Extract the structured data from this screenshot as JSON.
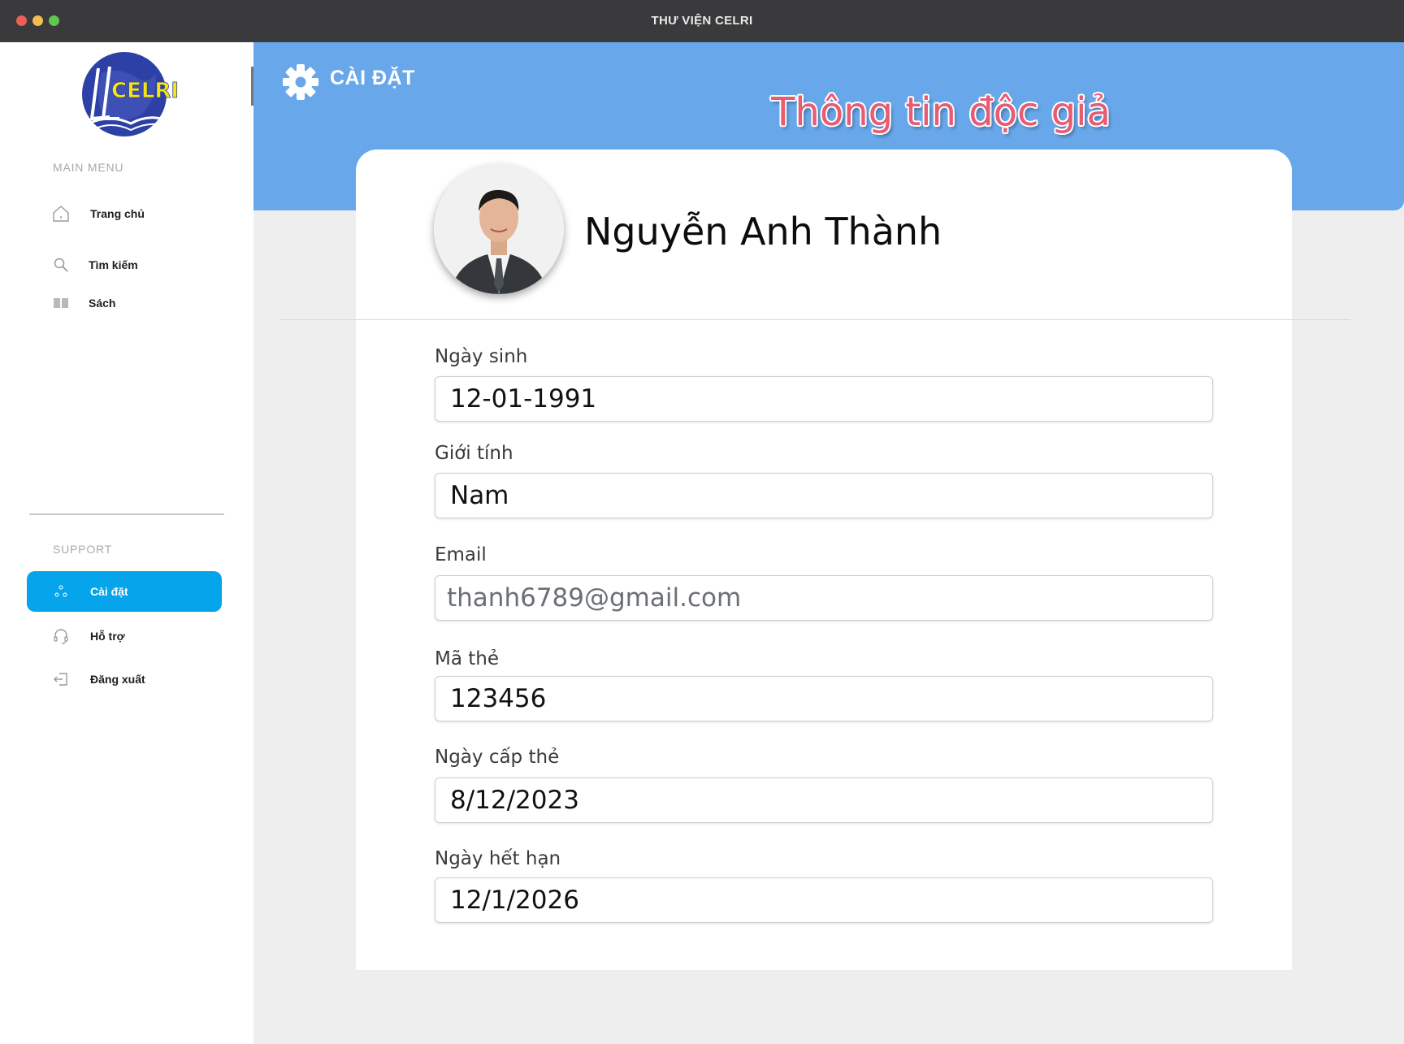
{
  "window": {
    "title": "THƯ VIỆN CELRI"
  },
  "sidebar": {
    "logo_text": "CELRI",
    "main_menu_label": "MAIN MENU",
    "support_label": "SUPPORT",
    "main_items": [
      {
        "label": "Trang chủ",
        "icon": "home-icon"
      },
      {
        "label": "Tìm kiếm",
        "icon": "search-icon"
      },
      {
        "label": "Sách",
        "icon": "book-icon"
      }
    ],
    "support_items": [
      {
        "label": "Cài đặt",
        "icon": "settings-icon",
        "active": true
      },
      {
        "label": "Hỗ trợ",
        "icon": "headset-icon"
      },
      {
        "label": "Đăng xuất",
        "icon": "logout-icon"
      }
    ]
  },
  "header": {
    "section_label": "CÀI ĐẶT",
    "heading": "Thông tin độc giả"
  },
  "profile": {
    "name": "Nguyễn Anh Thành",
    "fields": [
      {
        "label": "Ngày sinh",
        "value": "12-01-1991"
      },
      {
        "label": "Giới tính",
        "value": "Nam"
      },
      {
        "label": "Email",
        "value": "thanh6789@gmail.com"
      },
      {
        "label": "Mã thẻ",
        "value": "123456"
      },
      {
        "label": "Ngày cấp thẻ",
        "value": "8/12/2023"
      },
      {
        "label": "Ngày hết hạn",
        "value": "12/1/2026"
      }
    ]
  },
  "colors": {
    "header_bg": "#68a8ea",
    "active_nav": "#05a4eb",
    "heading_text": "#e75b73",
    "logo_yellow": "#f6e60a",
    "logo_blue": "#2d40a6"
  }
}
